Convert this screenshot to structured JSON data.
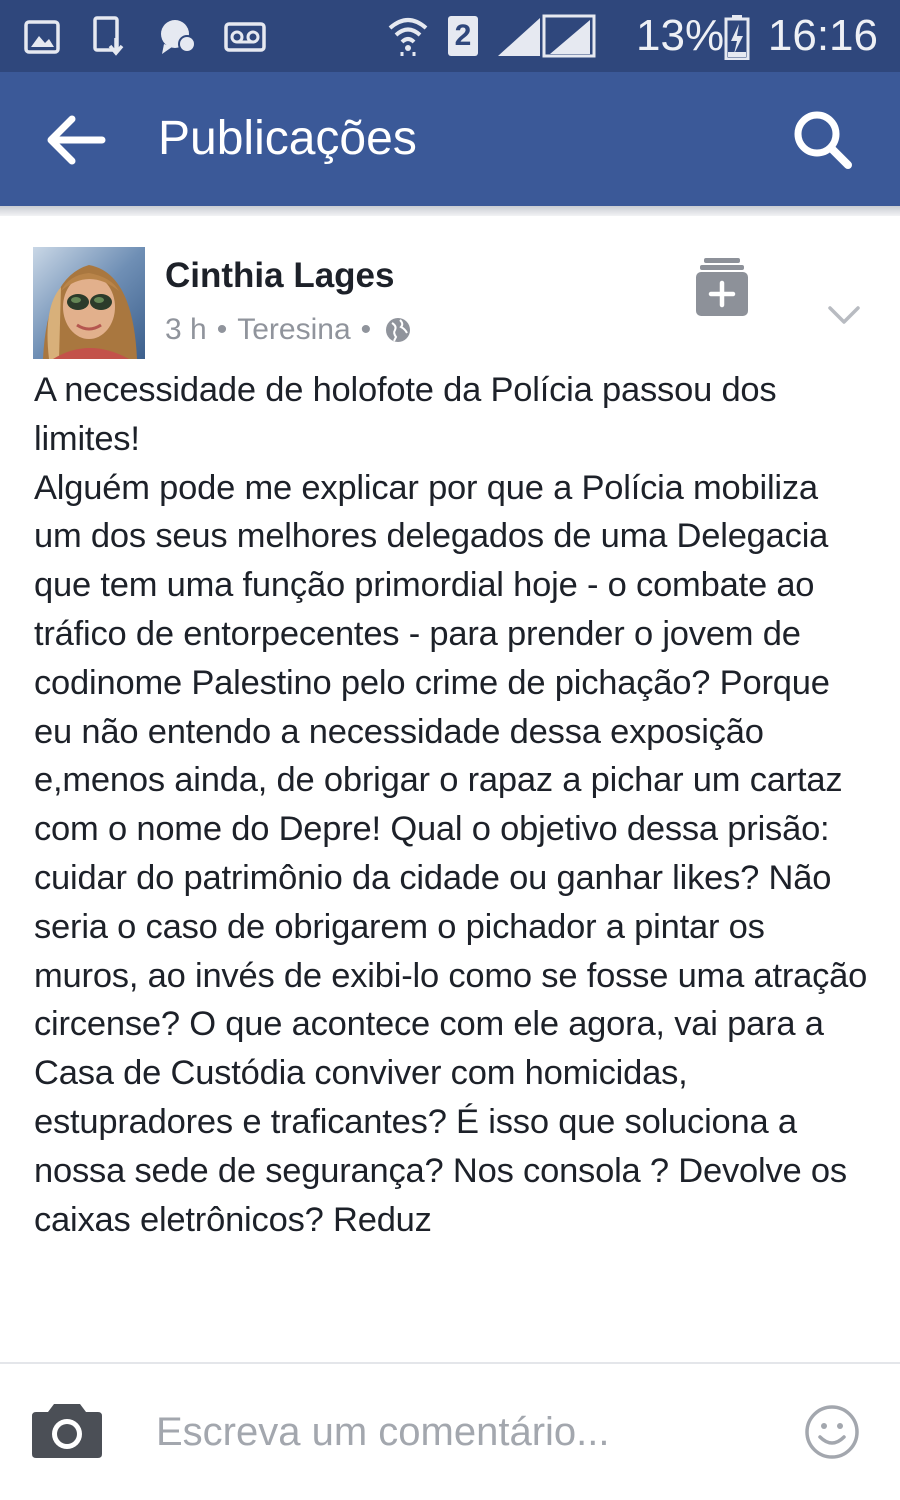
{
  "status_bar": {
    "battery_percent": "13%",
    "time": "16:16",
    "sim_slot": "2",
    "icons": [
      "gallery-icon",
      "download-icon",
      "messenger-icon",
      "voicemail-icon",
      "wifi-icon",
      "sim-icon",
      "signal-icon",
      "battery-charging-icon"
    ]
  },
  "app_bar": {
    "title": "Publicações",
    "back_icon": "arrow-left-icon",
    "search_icon": "search-icon",
    "background": "#3b5998"
  },
  "post": {
    "author": "Cinthia Lages",
    "time": "3 h",
    "separator": "•",
    "location": "Teresina",
    "privacy_icon": "globe-icon",
    "save_icon": "save-post-icon",
    "menu_icon": "chevron-down-icon",
    "text": "A necessidade de holofote da Polícia passou dos limites!\nAlguém pode me explicar por que a Polícia mobiliza um dos seus melhores delegados de uma Delegacia que tem uma função primordial hoje - o combate ao tráfico de entorpecentes - para prender o jovem de codinome Palestino pelo crime de pichação? Porque eu não entendo a necessidade dessa exposição e,menos ainda, de obrigar o rapaz a pichar um cartaz com o nome do Depre! Qual o objetivo dessa prisão: cuidar do patrimônio da cidade ou ganhar likes? Não seria o caso de obrigarem o pichador a pintar os muros, ao invés de exibi-lo como se fosse uma atração circense? O que acontece com ele agora, vai para a Casa de Custódia conviver com homicidas, estupradores e traficantes? É isso que soluciona a nossa sede de segurança? Nos consola ? Devolve os caixas eletrônicos? Reduz"
  },
  "comment_bar": {
    "placeholder": "Escreva um comentário...",
    "camera_icon": "camera-icon",
    "emoji_icon": "emoji-icon"
  }
}
